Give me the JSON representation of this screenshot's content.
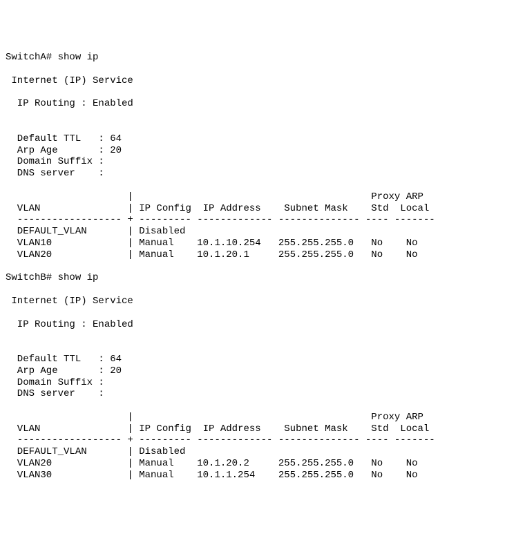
{
  "switchA": {
    "prompt": "SwitchA# show ip",
    "service_header": " Internet (IP) Service",
    "routing": "  IP Routing : Enabled",
    "settings": {
      "ttl_label": "  Default TTL   : ",
      "ttl_value": "64",
      "arp_label": "  Arp Age       : ",
      "arp_value": "20",
      "domain_label": "  Domain Suffix :",
      "dns_label": "  DNS server    :"
    },
    "table": {
      "h1": "                     |                                         Proxy ARP",
      "h2": "  VLAN               | IP Config  IP Address    Subnet Mask    Std  Local",
      "rule": "  ------------------ + --------- ------------- -------------- ---- -------",
      "rows": [
        "  DEFAULT_VLAN       | Disabled",
        "  VLAN10             | Manual    10.1.10.254   255.255.255.0   No    No",
        "  VLAN20             | Manual    10.1.20.1     255.255.255.0   No    No"
      ]
    }
  },
  "switchB": {
    "prompt": "SwitchB# show ip",
    "service_header": " Internet (IP) Service",
    "routing": "  IP Routing : Enabled",
    "settings": {
      "ttl_label": "  Default TTL   : ",
      "ttl_value": "64",
      "arp_label": "  Arp Age       : ",
      "arp_value": "20",
      "domain_label": "  Domain Suffix :",
      "dns_label": "  DNS server    :"
    },
    "table": {
      "h1": "                     |                                         Proxy ARP",
      "h2": "  VLAN               | IP Config  IP Address    Subnet Mask    Std  Local",
      "rule": "  ------------------ + --------- ------------- -------------- ---- -------",
      "rows": [
        "  DEFAULT_VLAN       | Disabled",
        "  VLAN20             | Manual    10.1.20.2     255.255.255.0   No    No",
        "  VLAN30             | Manual    10.1.1.254    255.255.255.0   No    No"
      ]
    }
  }
}
